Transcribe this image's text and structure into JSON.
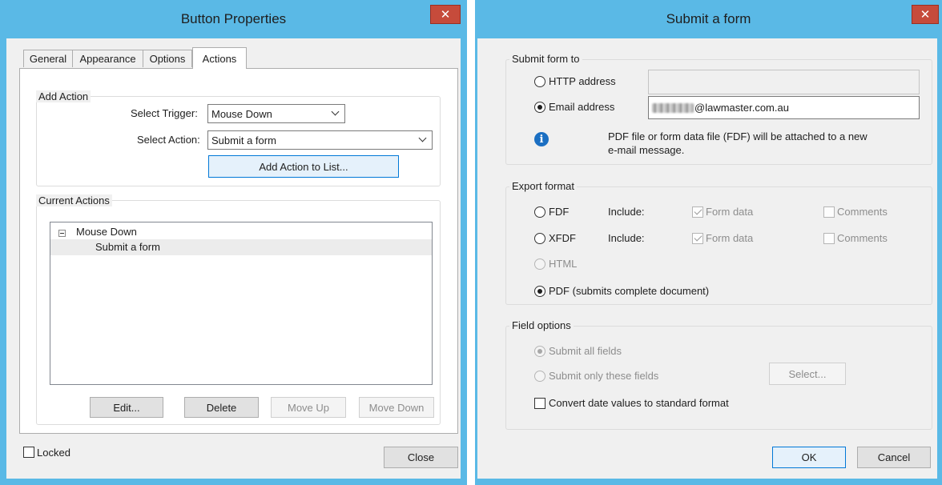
{
  "left_dialog": {
    "title": "Button Properties",
    "tabs": [
      {
        "label": "General"
      },
      {
        "label": "Appearance"
      },
      {
        "label": "Options"
      },
      {
        "label": "Actions"
      }
    ],
    "add_action": {
      "group_label": "Add Action",
      "trigger_label": "Select Trigger:",
      "trigger_value": "Mouse Down",
      "action_label": "Select Action:",
      "action_value": "Submit a form",
      "add_button": "Add Action to List..."
    },
    "current_actions": {
      "group_label": "Current Actions",
      "tree": {
        "parent": "Mouse Down",
        "child": "Submit a form"
      },
      "buttons": {
        "edit": "Edit...",
        "delete": "Delete",
        "move_up": "Move Up",
        "move_down": "Move Down"
      }
    },
    "locked_label": "Locked",
    "close_button": "Close"
  },
  "right_dialog": {
    "title": "Submit a form",
    "submit_to": {
      "group_label": "Submit form to",
      "http_label": "HTTP address",
      "http_value": "",
      "email_label": "Email address",
      "email_value": "@lawmaster.com.au",
      "info_text_line1": "PDF file or form data file (FDF) will be attached to a new",
      "info_text_line2": "e-mail message."
    },
    "export_format": {
      "group_label": "Export format",
      "fdf_label": "FDF",
      "xfdf_label": "XFDF",
      "html_label": "HTML",
      "pdf_label": "PDF (submits complete document)",
      "include_label": "Include:",
      "form_data_label": "Form data",
      "comments_label": "Comments"
    },
    "field_options": {
      "group_label": "Field options",
      "all_fields_label": "Submit all fields",
      "only_fields_label": "Submit only these fields",
      "select_button": "Select...",
      "convert_dates_label": "Convert date values to standard format"
    },
    "ok_button": "OK",
    "cancel_button": "Cancel"
  },
  "colors": {
    "titlebar": "#5ab9e6",
    "close_button": "#c64b3b",
    "dialog_bg": "#f0f0f0",
    "focus_border": "#0078d7",
    "info_icon": "#1b6fc2"
  }
}
